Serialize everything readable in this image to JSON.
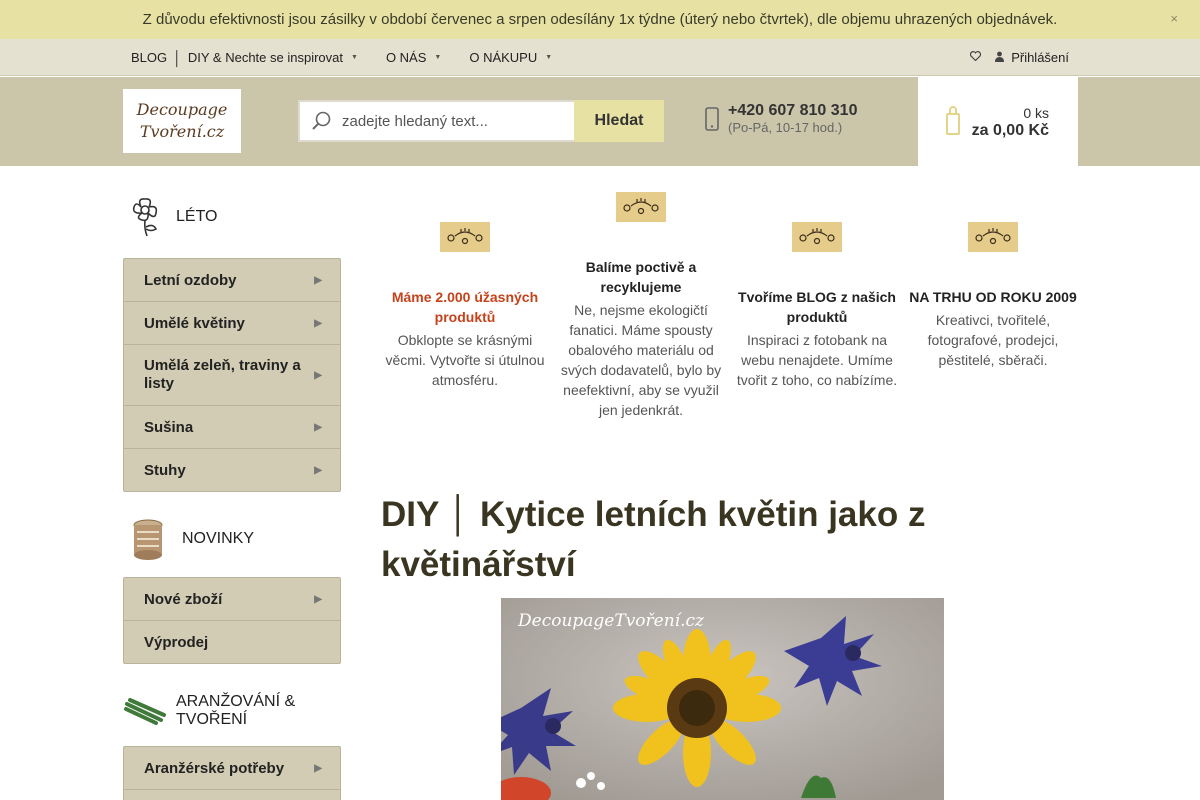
{
  "notice": {
    "text": "Z důvodu efektivnosti jsou zásilky v období červenec a srpen odesílány 1x týdne (úterý nebo čtvrtek), dle objemu uhrazených objednávek.",
    "close_icon": "×"
  },
  "nav": {
    "blog": "BLOG",
    "pipe": "│",
    "diy": "DIY & Nechte se inspirovat",
    "about": "O NÁS",
    "shopping": "O NÁKUPU",
    "caret": "▼",
    "login": "Přihlášení",
    "icons": [
      "heart-icon",
      "user-icon"
    ]
  },
  "header": {
    "logo_line1": "Decoupage",
    "logo_line2": "Tvoření.cz",
    "search_placeholder": "zadejte hledaný text...",
    "search_button": "Hledat",
    "phone": "+420 607 810 310",
    "phone_hours": "(Po-Pá, 10-17 hod.)",
    "cart_count": "0 ks",
    "cart_total": "za 0,00 Kč"
  },
  "sidebar": {
    "sections": [
      {
        "title": "LÉTO",
        "thumb": "flower-outline-icon",
        "items": [
          {
            "label": "Letní ozdoby",
            "arrow": "▶"
          },
          {
            "label": "Umělé květiny",
            "arrow": "▶"
          },
          {
            "label": "Umělá zeleň, traviny a listy",
            "arrow": "▶"
          },
          {
            "label": "Sušina",
            "arrow": "▶"
          },
          {
            "label": "Stuhy",
            "arrow": "▶"
          }
        ]
      },
      {
        "title": "NOVINKY",
        "thumb": "wooden-box-icon",
        "items": [
          {
            "label": "Nové zboží",
            "arrow": "▶"
          },
          {
            "label": "Výprodej",
            "arrow": ""
          }
        ]
      },
      {
        "title": "ARANŽOVÁNÍ & TVOŘENÍ",
        "thumb": "green-sticks-icon",
        "items": [
          {
            "label": "Aranžérské potřeby",
            "arrow": "▶"
          }
        ]
      }
    ]
  },
  "features": [
    {
      "title": "Máme 2.000 úžasných produktů",
      "desc": "Obklopte se krásnými věcmi. Vytvořte si útulnou atmosféru.",
      "highlight": true
    },
    {
      "title": "Balíme poctivě a recyklujeme",
      "desc": "Ne, nejsme ekologičtí fanatici. Máme spousty obalového materiálu od svých dodavatelů, bylo by neefektivní, aby se využil jen jedenkrát.",
      "highlight": false
    },
    {
      "title": "Tvoříme BLOG z našich produktů",
      "desc": "Inspiraci z fotobank na webu nenajdete. Umíme tvořit z toho, co nabízíme.",
      "highlight": false
    },
    {
      "title": "NA TRHU OD ROKU 2009",
      "desc": "Kreativci, tvořitelé, fotografové, prodejci, pěstitelé, sběrači.",
      "highlight": false
    }
  ],
  "article": {
    "title": "DIY │ Kytice letních květin jako z květinářství",
    "image_watermark": "DecoupageTvoření.cz"
  },
  "colors": {
    "notice_bg": "#e7e2a4",
    "header_bg": "#cbc5aa",
    "menu_bg": "#d2ccb4",
    "highlight_red": "#c5421b",
    "title_dark": "#3a3520"
  }
}
